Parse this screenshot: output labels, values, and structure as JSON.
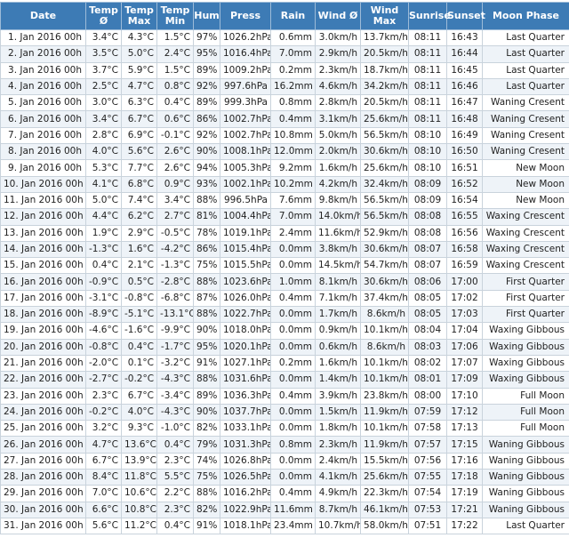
{
  "columns": [
    "Date",
    "Temp Ø",
    "Temp Max",
    "Temp Min",
    "Hum",
    "Press",
    "Rain",
    "Wind Ø",
    "Wind Max",
    "Sunrise",
    "Sunset",
    "Moon Phase"
  ],
  "rows": [
    [
      "1. Jan 2016 00h",
      "3.4°C",
      "4.3°C",
      "1.5°C",
      "97%",
      "1026.2hPa",
      "0.6mm",
      "3.0km/h",
      "13.7km/h",
      "08:11",
      "16:43",
      "Last Quarter"
    ],
    [
      "2. Jan 2016 00h",
      "3.5°C",
      "5.0°C",
      "2.4°C",
      "95%",
      "1016.4hPa",
      "7.0mm",
      "2.9km/h",
      "20.5km/h",
      "08:11",
      "16:44",
      "Last Quarter"
    ],
    [
      "3. Jan 2016 00h",
      "3.7°C",
      "5.9°C",
      "1.5°C",
      "89%",
      "1009.2hPa",
      "0.2mm",
      "2.3km/h",
      "18.7km/h",
      "08:11",
      "16:45",
      "Last Quarter"
    ],
    [
      "4. Jan 2016 00h",
      "2.5°C",
      "4.7°C",
      "0.8°C",
      "92%",
      "997.6hPa",
      "16.2mm",
      "4.6km/h",
      "34.2km/h",
      "08:11",
      "16:46",
      "Last Quarter"
    ],
    [
      "5. Jan 2016 00h",
      "3.0°C",
      "6.3°C",
      "0.4°C",
      "89%",
      "999.3hPa",
      "0.8mm",
      "2.8km/h",
      "20.5km/h",
      "08:11",
      "16:47",
      "Waning Cresent"
    ],
    [
      "6. Jan 2016 00h",
      "3.4°C",
      "6.7°C",
      "0.6°C",
      "86%",
      "1002.7hPa",
      "0.4mm",
      "3.1km/h",
      "25.6km/h",
      "08:11",
      "16:48",
      "Waning Cresent"
    ],
    [
      "7. Jan 2016 00h",
      "2.8°C",
      "6.9°C",
      "-0.1°C",
      "92%",
      "1002.7hPa",
      "10.8mm",
      "5.0km/h",
      "56.5km/h",
      "08:10",
      "16:49",
      "Waning Cresent"
    ],
    [
      "8. Jan 2016 00h",
      "4.0°C",
      "5.6°C",
      "2.6°C",
      "90%",
      "1008.1hPa",
      "12.0mm",
      "2.0km/h",
      "30.6km/h",
      "08:10",
      "16:50",
      "Waning Cresent"
    ],
    [
      "9. Jan 2016 00h",
      "5.3°C",
      "7.7°C",
      "2.6°C",
      "94%",
      "1005.3hPa",
      "9.2mm",
      "1.6km/h",
      "25.6km/h",
      "08:10",
      "16:51",
      "New Moon"
    ],
    [
      "10. Jan 2016 00h",
      "4.1°C",
      "6.8°C",
      "0.9°C",
      "93%",
      "1002.1hPa",
      "10.2mm",
      "4.2km/h",
      "32.4km/h",
      "08:09",
      "16:52",
      "New Moon"
    ],
    [
      "11. Jan 2016 00h",
      "5.0°C",
      "7.4°C",
      "3.4°C",
      "88%",
      "996.5hPa",
      "7.6mm",
      "9.8km/h",
      "56.5km/h",
      "08:09",
      "16:54",
      "New Moon"
    ],
    [
      "12. Jan 2016 00h",
      "4.4°C",
      "6.2°C",
      "2.7°C",
      "81%",
      "1004.4hPa",
      "7.0mm",
      "14.0km/h",
      "56.5km/h",
      "08:08",
      "16:55",
      "Waxing Crescent"
    ],
    [
      "13. Jan 2016 00h",
      "1.9°C",
      "2.9°C",
      "-0.5°C",
      "78%",
      "1019.1hPa",
      "2.4mm",
      "11.6km/h",
      "52.9km/h",
      "08:08",
      "16:56",
      "Waxing Crescent"
    ],
    [
      "14. Jan 2016 00h",
      "-1.3°C",
      "1.6°C",
      "-4.2°C",
      "86%",
      "1015.4hPa",
      "0.0mm",
      "3.8km/h",
      "30.6km/h",
      "08:07",
      "16:58",
      "Waxing Crescent"
    ],
    [
      "15. Jan 2016 00h",
      "0.4°C",
      "2.1°C",
      "-1.3°C",
      "75%",
      "1015.5hPa",
      "0.0mm",
      "14.5km/h",
      "54.7km/h",
      "08:07",
      "16:59",
      "Waxing Crescent"
    ],
    [
      "16. Jan 2016 00h",
      "-0.9°C",
      "0.5°C",
      "-2.8°C",
      "88%",
      "1023.6hPa",
      "1.0mm",
      "8.1km/h",
      "30.6km/h",
      "08:06",
      "17:00",
      "First Quarter"
    ],
    [
      "17. Jan 2016 00h",
      "-3.1°C",
      "-0.8°C",
      "-6.8°C",
      "87%",
      "1026.0hPa",
      "0.4mm",
      "7.1km/h",
      "37.4km/h",
      "08:05",
      "17:02",
      "First Quarter"
    ],
    [
      "18. Jan 2016 00h",
      "-8.9°C",
      "-5.1°C",
      "-13.1°C",
      "88%",
      "1022.7hPa",
      "0.0mm",
      "1.7km/h",
      "8.6km/h",
      "08:05",
      "17:03",
      "First Quarter"
    ],
    [
      "19. Jan 2016 00h",
      "-4.6°C",
      "-1.6°C",
      "-9.9°C",
      "90%",
      "1018.0hPa",
      "0.0mm",
      "0.9km/h",
      "10.1km/h",
      "08:04",
      "17:04",
      "Waxing Gibbous"
    ],
    [
      "20. Jan 2016 00h",
      "-0.8°C",
      "0.4°C",
      "-1.7°C",
      "95%",
      "1020.1hPa",
      "0.0mm",
      "0.6km/h",
      "8.6km/h",
      "08:03",
      "17:06",
      "Waxing Gibbous"
    ],
    [
      "21. Jan 2016 00h",
      "-2.0°C",
      "0.1°C",
      "-3.2°C",
      "91%",
      "1027.1hPa",
      "0.2mm",
      "1.6km/h",
      "10.1km/h",
      "08:02",
      "17:07",
      "Waxing Gibbous"
    ],
    [
      "22. Jan 2016 00h",
      "-2.7°C",
      "-0.2°C",
      "-4.3°C",
      "88%",
      "1031.6hPa",
      "0.0mm",
      "1.4km/h",
      "10.1km/h",
      "08:01",
      "17:09",
      "Waxing Gibbous"
    ],
    [
      "23. Jan 2016 00h",
      "2.3°C",
      "6.7°C",
      "-3.4°C",
      "89%",
      "1036.3hPa",
      "0.4mm",
      "3.9km/h",
      "23.8km/h",
      "08:00",
      "17:10",
      "Full Moon"
    ],
    [
      "24. Jan 2016 00h",
      "-0.2°C",
      "4.0°C",
      "-4.3°C",
      "90%",
      "1037.7hPa",
      "0.0mm",
      "1.5km/h",
      "11.9km/h",
      "07:59",
      "17:12",
      "Full Moon"
    ],
    [
      "25. Jan 2016 00h",
      "3.2°C",
      "9.3°C",
      "-1.0°C",
      "82%",
      "1033.1hPa",
      "0.0mm",
      "1.8km/h",
      "10.1km/h",
      "07:58",
      "17:13",
      "Full Moon"
    ],
    [
      "26. Jan 2016 00h",
      "4.7°C",
      "13.6°C",
      "0.4°C",
      "79%",
      "1031.3hPa",
      "0.8mm",
      "2.3km/h",
      "11.9km/h",
      "07:57",
      "17:15",
      "Waning Gibbous"
    ],
    [
      "27. Jan 2016 00h",
      "6.7°C",
      "13.9°C",
      "2.3°C",
      "74%",
      "1026.8hPa",
      "0.0mm",
      "2.4km/h",
      "15.5km/h",
      "07:56",
      "17:16",
      "Waning Gibbous"
    ],
    [
      "28. Jan 2016 00h",
      "8.4°C",
      "11.8°C",
      "5.5°C",
      "75%",
      "1026.5hPa",
      "0.0mm",
      "4.1km/h",
      "25.6km/h",
      "07:55",
      "17:18",
      "Waning Gibbous"
    ],
    [
      "29. Jan 2016 00h",
      "7.0°C",
      "10.6°C",
      "2.2°C",
      "88%",
      "1016.2hPa",
      "0.4mm",
      "4.9km/h",
      "22.3km/h",
      "07:54",
      "17:19",
      "Waning Gibbous"
    ],
    [
      "30. Jan 2016 00h",
      "6.6°C",
      "10.8°C",
      "2.3°C",
      "82%",
      "1022.9hPa",
      "11.6mm",
      "8.7km/h",
      "46.1km/h",
      "07:53",
      "17:21",
      "Waning Gibbous"
    ],
    [
      "31. Jan 2016 00h",
      "5.6°C",
      "11.2°C",
      "0.4°C",
      "91%",
      "1018.1hPa",
      "23.4mm",
      "10.7km/h",
      "58.0km/h",
      "07:51",
      "17:22",
      "Last Quarter"
    ]
  ]
}
